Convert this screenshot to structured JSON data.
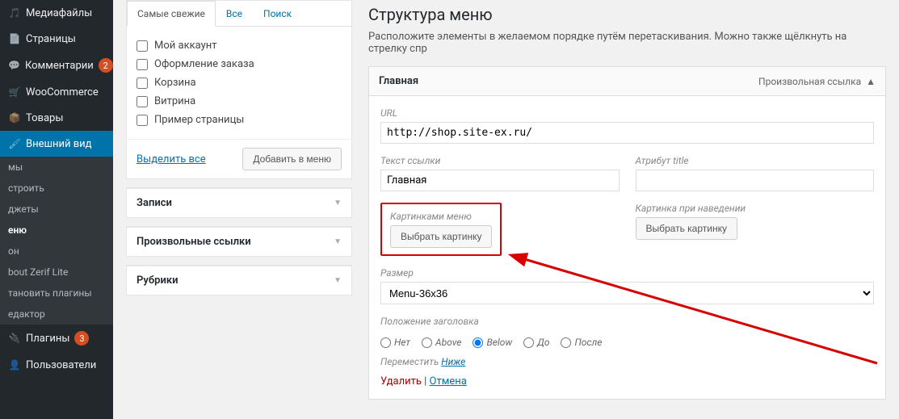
{
  "sidebar": {
    "items": [
      {
        "label": "Медиафайлы",
        "icon": "dash-media"
      },
      {
        "label": "Страницы",
        "icon": "dash-page"
      },
      {
        "label": "Комментарии",
        "icon": "dash-comment",
        "badge": "2"
      },
      {
        "label": "WooCommerce",
        "icon": "dash-cart"
      },
      {
        "label": "Товары",
        "icon": "dash-tag"
      },
      {
        "label": "Внешний вид",
        "icon": "dash-brush",
        "active": true
      }
    ],
    "sub": [
      {
        "label": "мы"
      },
      {
        "label": "строить"
      },
      {
        "label": "джеты"
      },
      {
        "label": "еню",
        "current": true
      },
      {
        "label": "он"
      },
      {
        "label": "bout Zerif Lite"
      },
      {
        "label": "тановить плагины"
      },
      {
        "label": "едактор"
      }
    ],
    "plugins": {
      "label": "Плагины",
      "badge": "3",
      "icon": "dash-plug"
    },
    "users": {
      "label": "Пользователи",
      "icon": "dash-user"
    }
  },
  "leftcol": {
    "tabs": [
      {
        "label": "Самые свежие",
        "active": true
      },
      {
        "label": "Все"
      },
      {
        "label": "Поиск"
      }
    ],
    "pages": [
      "Мой аккаунт",
      "Оформление заказа",
      "Корзина",
      "Витрина",
      "Пример страницы"
    ],
    "select_all": "Выделить все",
    "add_btn": "Добавить в меню",
    "accordions": [
      "Записи",
      "Произвольные ссылки",
      "Рубрики"
    ]
  },
  "rightcol": {
    "title": "Структура меню",
    "desc": "Расположите элементы в желаемом порядке путём перетаскивания. Можно также щёлкнуть на стрелку спр",
    "menuitem": {
      "name": "Главная",
      "type": "Произвольная ссылка",
      "url_label": "URL",
      "url_value": "http://shop.site-ex.ru/",
      "text_label": "Текст ссылки",
      "text_value": "Главная",
      "title_label": "Атрибут title",
      "title_value": "",
      "img_label": "Картинками меню",
      "img_hover_label": "Картинка при наведении",
      "img_btn": "Выбрать картинку",
      "size_label": "Размер",
      "size_value": "Menu-36x36",
      "pos_label": "Положение заголовка",
      "pos_options": [
        "Нет",
        "Above",
        "Below",
        "До",
        "После"
      ],
      "pos_selected": "Below",
      "move_label": "Переместить",
      "move_link": "Ниже",
      "delete": "Удалить",
      "cancel": "Отмена"
    }
  }
}
